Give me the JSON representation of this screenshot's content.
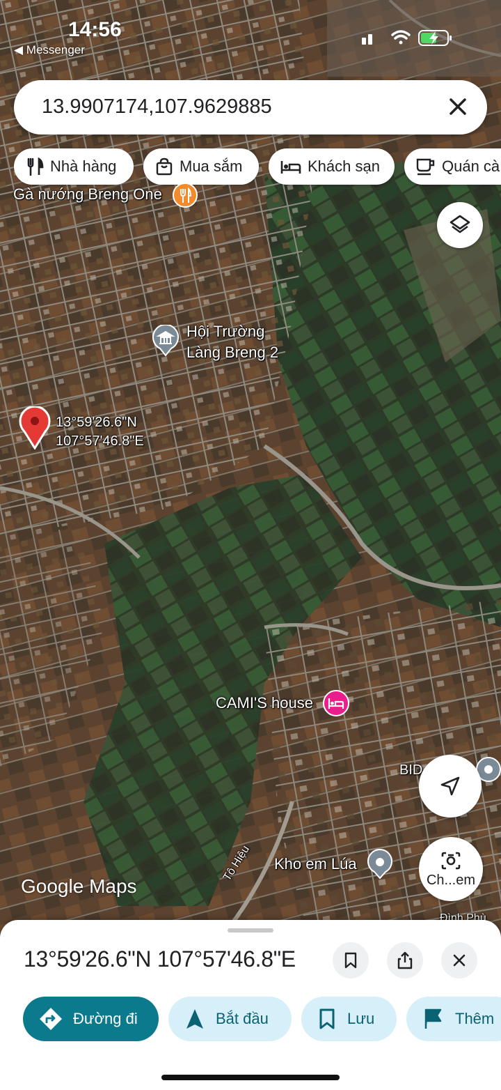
{
  "status": {
    "time": "14:56",
    "back_app": "◀ Messenger"
  },
  "search": {
    "query": "13.9907174,107.9629885"
  },
  "chips": [
    {
      "label": "Nhà hàng",
      "icon": "fork-knife-icon"
    },
    {
      "label": "Mua sắm",
      "icon": "shopping-bag-icon"
    },
    {
      "label": "Khách sạn",
      "icon": "bed-icon"
    },
    {
      "label": "Quán cà",
      "icon": "coffee-cup-icon"
    }
  ],
  "map": {
    "places": {
      "restaurant": "Gà nướng Breng One",
      "hall_line1": "Hội Trường",
      "hall_line2": "Làng Breng 2",
      "pin_line1": "13°59'26.6\"N",
      "pin_line2": "107°57'46.8\"E",
      "house": "CAMI'S house",
      "store": "Kho em Lúa",
      "bid": "BID",
      "road": "Tô Hiệu",
      "corner": "Đình Phù"
    },
    "logo": "Google Maps",
    "lens_label": "Ch...em",
    "colors": {
      "pin": "#e53935",
      "hotel_marker": "#e91e8c",
      "restaurant_marker": "#f28b2c",
      "poi_marker": "#7b8a97"
    }
  },
  "sheet": {
    "title": "13°59'26.6\"N 107°57'46.8\"E",
    "actions": {
      "directions": "Đường đi",
      "start": "Bắt đầu",
      "save": "Lưu",
      "more": "Thêm"
    },
    "colors": {
      "primary": "#0b7a8c",
      "secondary_bg": "#d6eff8",
      "icon": "#0b6273"
    }
  }
}
